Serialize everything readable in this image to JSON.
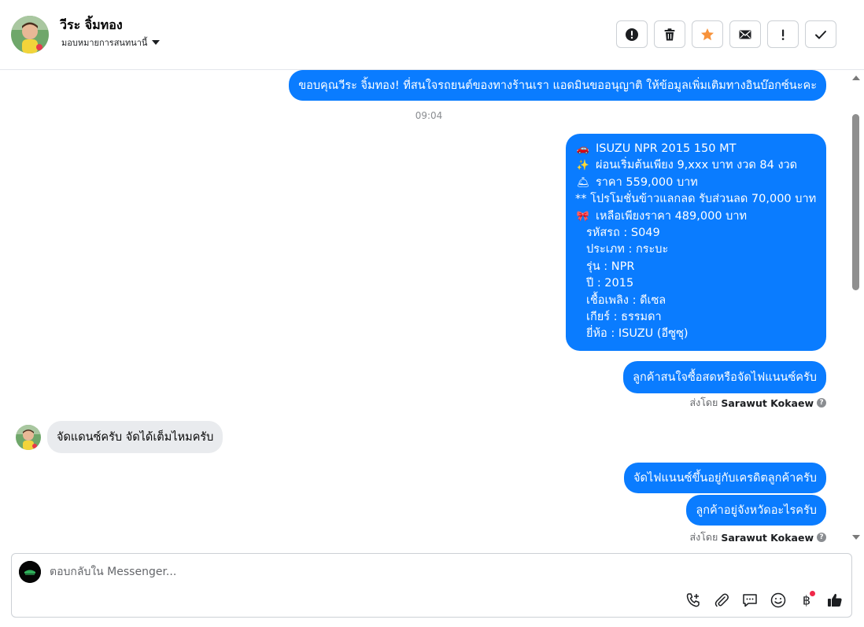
{
  "header": {
    "contact_name": "วีระ จิ้มทอง",
    "assign_label": "มอบหมายการสนทนานี้",
    "actions": [
      {
        "name": "report-spam",
        "icon": "alert-circle-icon"
      },
      {
        "name": "delete",
        "icon": "trash-icon"
      },
      {
        "name": "star",
        "icon": "star-icon"
      },
      {
        "name": "mark-unread",
        "icon": "envelope-icon"
      },
      {
        "name": "follow-up",
        "icon": "exclamation-icon"
      },
      {
        "name": "mark-done",
        "icon": "check-icon"
      }
    ]
  },
  "conversation": {
    "msg_greeting": "ขอบคุณวีระ จิ้มทอง! ที่สนใจรถยนต์ของทางร้านเรา แอดมินขออนุญาติ ให้ข้อมูลเพิ่มเติมทางอินบ๊อกซ์นะคะ",
    "timestamp": "09:04",
    "card": {
      "line1": {
        "emoji": "🚗",
        "text": "ISUZU NPR 2015 150 MT"
      },
      "line2": {
        "emoji": "✨",
        "text": "ผ่อนเริ่มต้นเพียง 9,xxx บาท งวด 84 งวด"
      },
      "line3": {
        "emoji": "🛎",
        "text": " ราคา 559,000 บาท"
      },
      "line4": "** โปรโมชั่นข้าวแลกลด รับส่วนลด 70,000 บาท",
      "line5": {
        "emoji": "🎀",
        "text": "เหลือเพียงราคา 489,000 บาท"
      },
      "details": [
        "รหัสรถ : S049",
        "ประเภท : กระบะ",
        "รุ่น : NPR",
        "ปี : 2015",
        "เชื้อเพลิง : ดีเซล",
        "เกียร์ : ธรรมดา",
        "ยี่ห้อ : ISUZU (อีซูซุ)"
      ]
    },
    "msg_question1": "ลูกค้าสนใจซื้อสดหรือจัดไฟแนนซ์ครับ",
    "sent_by_prefix": "ส่งโดย",
    "sent_by_name": "Sarawut Kokaew",
    "msg_incoming": "จัดแดนซ์ครับ  จัดได้เต็มไหมครับ",
    "msg_reply1": "จัดไฟแนนซ์ขึ้นอยู่กับเครดิตลูกค้าครับ",
    "msg_reply2": "ลูกค้าอยู่จังหวัดอะไรครับ",
    "sent_by_prefix2": "ส่งโดย",
    "sent_by_name2": "Sarawut Kokaew"
  },
  "composer": {
    "placeholder": "ตอบกลับใน Messenger...",
    "tools": [
      "phone-add-icon",
      "paperclip-icon",
      "saved-reply-icon",
      "emoji-icon",
      "baht-payment-icon",
      "thumbs-up-icon"
    ]
  },
  "colors": {
    "outgoing_bubble": "#0a7cff",
    "incoming_bubble": "#e9ebee",
    "star_accent": "#f7923a",
    "notification_dot": "#f02849"
  }
}
